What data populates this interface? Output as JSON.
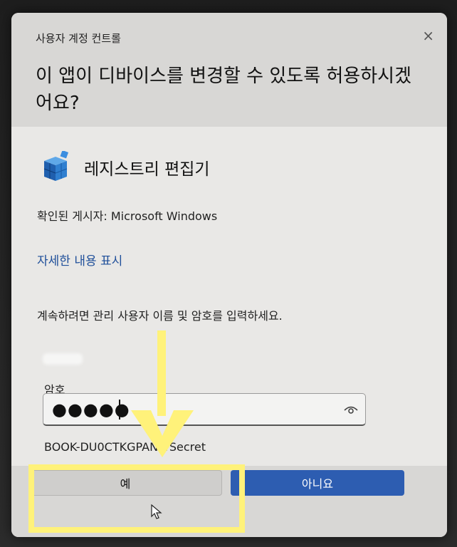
{
  "dialog": {
    "caption": "사용자 계정 컨트롤",
    "close_glyph": "×",
    "question": "이 앱이 디바이스를 변경할 수 있도록 허용하시겠어요?",
    "app_name": "레지스트리 편집기",
    "publisher": "확인된 게시자: Microsoft Windows",
    "details_link": "자세한 내용 표시",
    "instruction": "계속하려면 관리 사용자 이름 및 암호를 입력하세요.",
    "password_label": "암호",
    "password_value": "●●●●●",
    "domain_user": "BOOK-DU0CTKGPAN₩Secret",
    "yes_label": "예",
    "no_label": "아니요"
  },
  "colors": {
    "primary_button": "#2d5db1",
    "link": "#1f4f9a",
    "annotation": "#fff27a"
  },
  "icons": {
    "app": "registry-editor-icon",
    "reveal": "eye-icon",
    "annotation_arrow": "arrow-down-icon",
    "pointer": "mouse-cursor-icon"
  }
}
